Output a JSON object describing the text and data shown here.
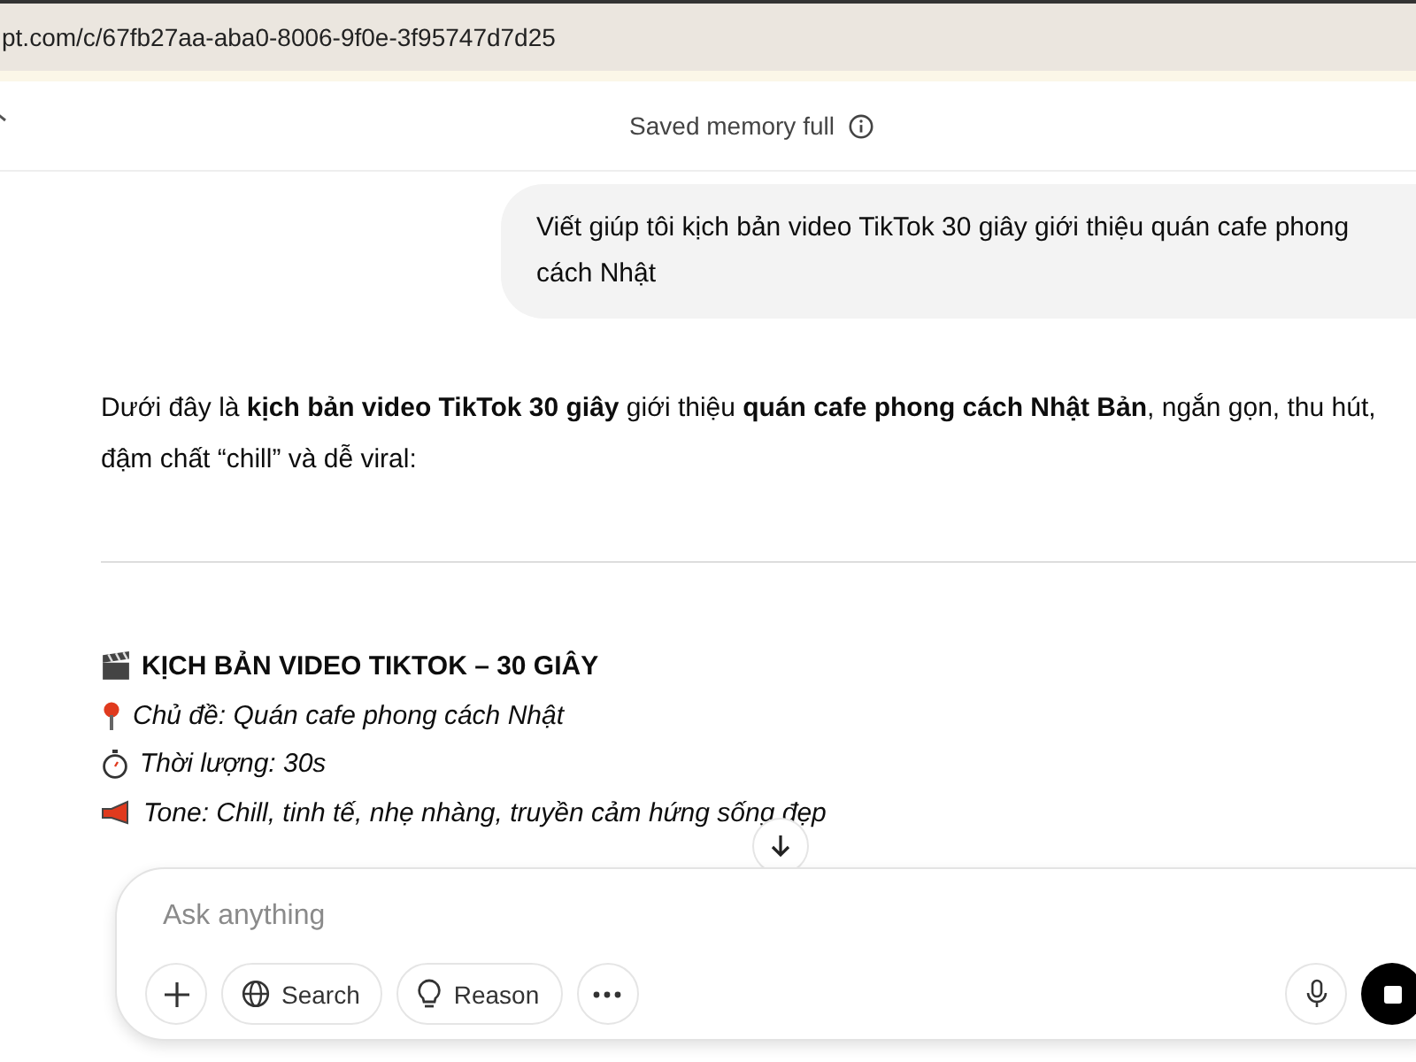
{
  "address_bar": {
    "url": "pt.com/c/67fb27aa-aba0-8006-9f0e-3f95747d7d25"
  },
  "header": {
    "title": "Saved memory full"
  },
  "user_message": {
    "text": "Viết giúp tôi kịch bản video TikTok 30 giây giới thiệu quán cafe phong cách Nhật"
  },
  "assistant_message": {
    "intro": "Dưới đây là **kịch bản video TikTok 30 giây** giới thiệu **quán cafe phong cách Nhật Bản**, ngắn gọn, thu hút, đậm chất “chill” và dễ viral:",
    "heading": "KỊCH BẢN VIDEO TIKTOK – 30 GIÂY",
    "details": [
      {
        "kind": "pin",
        "text": "Chủ đề: Quán cafe phong cách Nhật"
      },
      {
        "kind": "stopwatch",
        "text": "Thời lượng: 30s"
      },
      {
        "kind": "megaphone",
        "text": "Tone: Chill, tinh tế, nhẹ nhàng, truyền cảm hứng sống đẹp"
      }
    ]
  },
  "composer": {
    "placeholder": "Ask anything",
    "buttons": [
      {
        "kind": "plus"
      },
      {
        "kind": "search",
        "label": "Search"
      },
      {
        "kind": "reason",
        "label": "Reason"
      },
      {
        "kind": "more"
      }
    ]
  }
}
